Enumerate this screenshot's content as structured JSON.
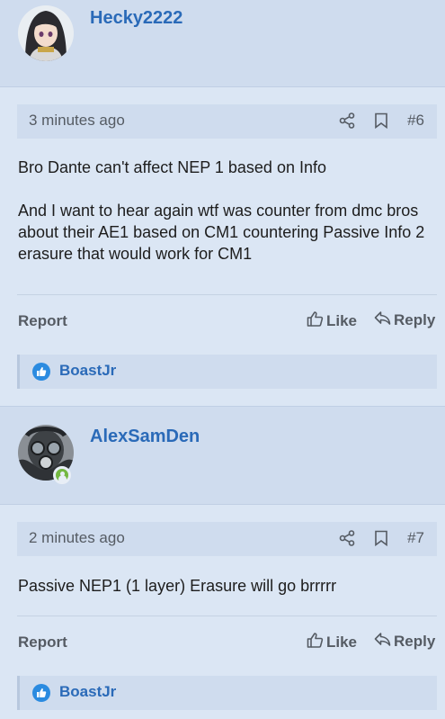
{
  "posts": [
    {
      "username": "Hecky2222",
      "time": "3 minutes ago",
      "number": "#6",
      "paragraphs": [
        "Bro Dante can't affect NEP 1 based on Info",
        "And I want to hear again wtf was counter from dmc bros about their AE1 based on CM1 countering Passive Info 2 erasure that would work for CM1"
      ],
      "report_label": "Report",
      "like_label": "Like",
      "reply_label": "Reply",
      "reaction_user": "BoastJr"
    },
    {
      "username": "AlexSamDen",
      "time": "2 minutes ago",
      "number": "#7",
      "paragraphs": [
        "Passive NEP1 (1 layer) Erasure will go brrrrr"
      ],
      "report_label": "Report",
      "like_label": "Like",
      "reply_label": "Reply",
      "reaction_user": "BoastJr"
    }
  ],
  "icons": {
    "share": "share-icon",
    "bookmark": "bookmark-icon",
    "like": "thumbs-up-icon",
    "reply": "reply-icon",
    "reaction": "like-reaction-icon"
  },
  "colors": {
    "background": "#dbe6f4",
    "panel": "#cfdcee",
    "link": "#2a6ab8",
    "reaction_blue": "#2b8be0",
    "online_green": "#74b842"
  }
}
